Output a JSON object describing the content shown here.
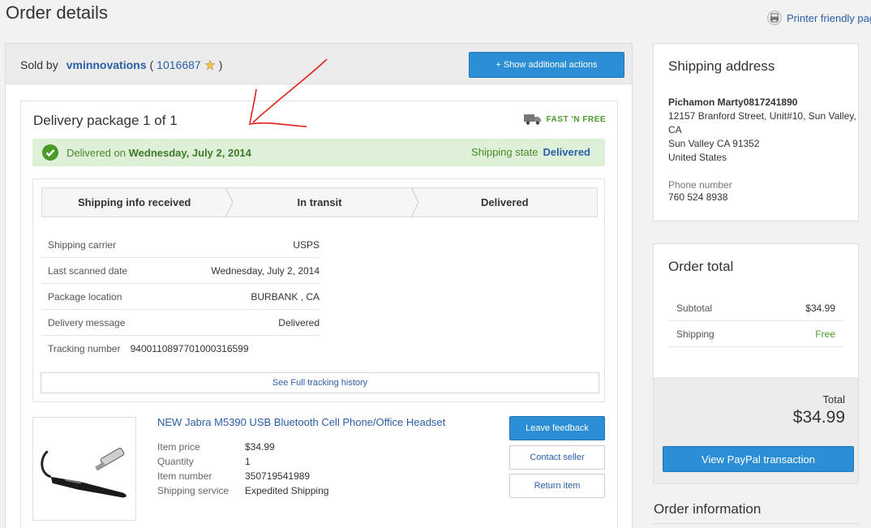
{
  "page": {
    "title": "Order details",
    "printer_label": "Printer friendly pag"
  },
  "seller": {
    "sold_by": "Sold by",
    "name": "vminnovations",
    "open_paren": "(",
    "feedback": "1016687",
    "close_paren": ")",
    "show_actions": "+ Show additional actions"
  },
  "package": {
    "title": "Delivery package 1 of 1",
    "badge": "FAST 'N FREE",
    "delivered_on_prefix": "Delivered on",
    "delivered_date": "Wednesday, July 2, 2014",
    "shipping_state_label": "Shipping state",
    "shipping_state_value": "Delivered",
    "steps": [
      "Shipping info received",
      "In transit",
      "Delivered"
    ],
    "details": [
      {
        "k": "Shipping carrier",
        "v": "USPS"
      },
      {
        "k": "Last scanned date",
        "v": "Wednesday, July 2, 2014"
      },
      {
        "k": "Package location",
        "v": "BURBANK , CA"
      },
      {
        "k": "Delivery message",
        "v": "Delivered"
      },
      {
        "k": "Tracking number",
        "v": "9400110897701000316599"
      }
    ],
    "history_link": "See Full tracking history"
  },
  "item": {
    "title": "NEW Jabra M5390 USB Bluetooth Cell Phone/Office Headset",
    "rows": [
      {
        "k": "Item price",
        "v": "$34.99"
      },
      {
        "k": "Quantity",
        "v": "1"
      },
      {
        "k": "Item number",
        "v": "350719541989"
      },
      {
        "k": "Shipping service",
        "v": "Expedited Shipping"
      }
    ],
    "leave_feedback": "Leave feedback",
    "contact_seller": "Contact seller",
    "return_item": "Return item"
  },
  "shipping_address": {
    "title": "Shipping address",
    "name": "Pichamon Marty0817241890",
    "line1": "12157 Branford Street, Unit#10, Sun Valley, CA",
    "line2": "Sun Valley CA 91352",
    "line3": "United States",
    "phone_label": "Phone number",
    "phone": "760 524 8938"
  },
  "order_total": {
    "title": "Order total",
    "subtotal_label": "Subtotal",
    "subtotal": "$34.99",
    "shipping_label": "Shipping",
    "shipping": "Free",
    "total_label": "Total",
    "total": "$34.99",
    "paypal_button": "View PayPal transaction"
  },
  "order_information": {
    "title": "Order information"
  },
  "colors": {
    "link": "#2a5ea8",
    "primary_button": "#2c8fd6",
    "success_bg": "#dff0d8",
    "success_text": "#4a8a2a",
    "annotation": "#e0201a"
  },
  "icons": [
    "printer-icon",
    "feedback-star-icon",
    "truck-icon",
    "check-circle-icon"
  ]
}
